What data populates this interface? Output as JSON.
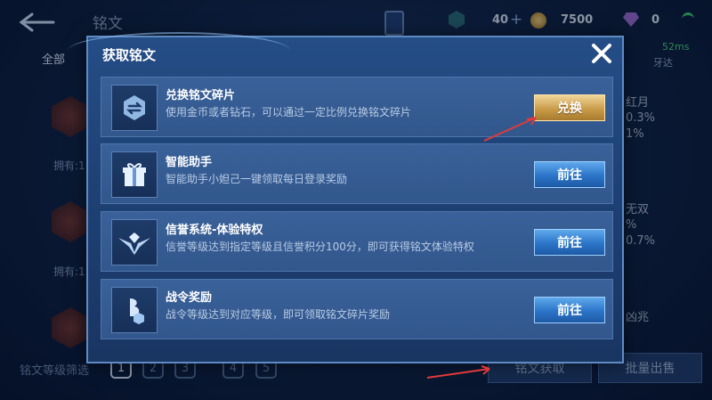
{
  "background": {
    "title": "铭文",
    "tab_all": "全部",
    "resource_hex": "40",
    "resource_gold": "7500",
    "resource_gem": "0",
    "ping": "52ms",
    "network": "牙达",
    "side_items": [
      "拥有:1",
      "拥有:1"
    ],
    "right_labels": [
      "红月",
      "0.3%",
      "1%",
      "无双",
      "%",
      "0.7%",
      "凶兆"
    ],
    "level_filter_label": "铭文等级筛选",
    "levels": [
      "1",
      "2",
      "3",
      "4",
      "5"
    ],
    "btn_acquire": "铭文获取",
    "btn_batch_sell": "批量出售"
  },
  "modal": {
    "title": "获取铭文",
    "rows": [
      {
        "title": "兑换铭文碎片",
        "desc": "使用金币或者钻石，可以通过一定比例兑换铭文碎片",
        "button": "兑换",
        "icon": "exchange-icon"
      },
      {
        "title": "智能助手",
        "desc": "智能助手小妲己一键领取每日登录奖励",
        "button": "前往",
        "icon": "gift-icon"
      },
      {
        "title": "信誉系统-体验特权",
        "desc": "信誉等级达到指定等级且信誉积分100分，即可获得铭文体验特权",
        "button": "前往",
        "icon": "credit-badge-icon"
      },
      {
        "title": "战令奖励",
        "desc": "战令等级达到对应等级，即可领取铭文碎片奖励",
        "button": "前往",
        "icon": "battle-pass-icon"
      }
    ]
  },
  "colors": {
    "gold_button": "#c99c49",
    "blue_button": "#2b74c8",
    "annotation_arrow": "#e23a3a"
  }
}
